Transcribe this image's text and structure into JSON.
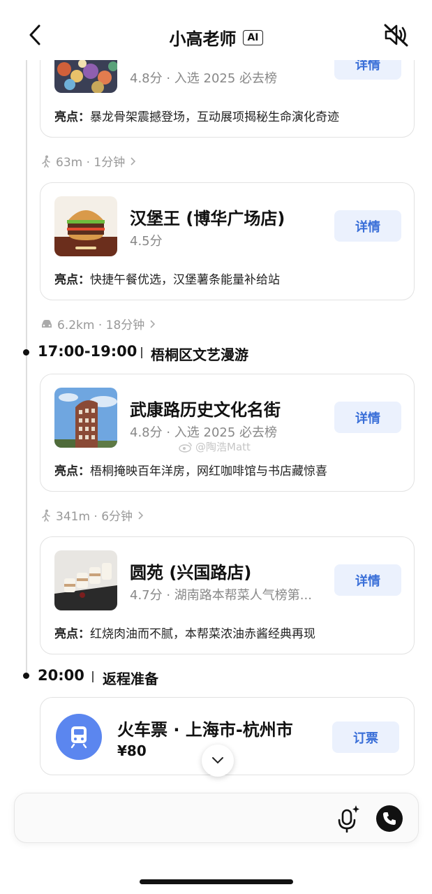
{
  "header": {
    "title": "小高老师",
    "badge": "AI",
    "back_icon": "chevron-left-icon",
    "mute_icon": "speaker-muted-icon"
  },
  "cards": [
    {
      "name": "",
      "meta": "4.8分 · 入选 2025 必去榜",
      "detail_label": "详情",
      "highlight_label": "亮点：",
      "highlight_text": "暴龙骨架震撼登场，互动展项揭秘生命演化奇迹",
      "thumb": "coral-reef-image"
    },
    {
      "name": "汉堡王 (博华广场店)",
      "meta": "4.5分",
      "detail_label": "详情",
      "highlight_label": "亮点：",
      "highlight_text": "快捷午餐优选，汉堡薯条能量补给站",
      "thumb": "burger-image"
    },
    {
      "name": "武康路历史文化名街",
      "meta": "4.8分 · 入选 2025 必去榜",
      "detail_label": "详情",
      "highlight_label": "亮点：",
      "highlight_text": "梧桐掩映百年洋房，网红咖啡馆与书店藏惊喜",
      "thumb": "wukang-building-image"
    },
    {
      "name": "圆苑 (兴国路店)",
      "meta": "4.7分 · 湖南路本帮菜人气榜第...",
      "detail_label": "详情",
      "highlight_label": "亮点：",
      "highlight_text": "红烧肉油而不腻，本帮菜浓油赤酱经典再现",
      "thumb": "braised-pork-image"
    }
  ],
  "transits": [
    {
      "mode": "walk-icon",
      "text": "63m · 1分钟"
    },
    {
      "mode": "car-icon",
      "text": "6.2km · 18分钟"
    },
    {
      "mode": "walk-icon",
      "text": "341m · 6分钟"
    }
  ],
  "slots": [
    {
      "time": "17:00-19:00",
      "title": "梧桐区文艺漫游"
    },
    {
      "time": "20:00",
      "title": "返程准备"
    }
  ],
  "ticket": {
    "title": "火车票 · 上海市-杭州市",
    "price": "¥80",
    "book_label": "订票",
    "icon": "train-icon"
  },
  "watermark": "@陶浩Matt",
  "input": {
    "placeholder": "",
    "mic_icon": "ai-microphone-icon",
    "phone_icon": "phone-icon"
  },
  "colors": {
    "accent": "#3a6fd8",
    "button_bg": "#ebf1fd",
    "train_icon_bg": "#5b86ef"
  }
}
